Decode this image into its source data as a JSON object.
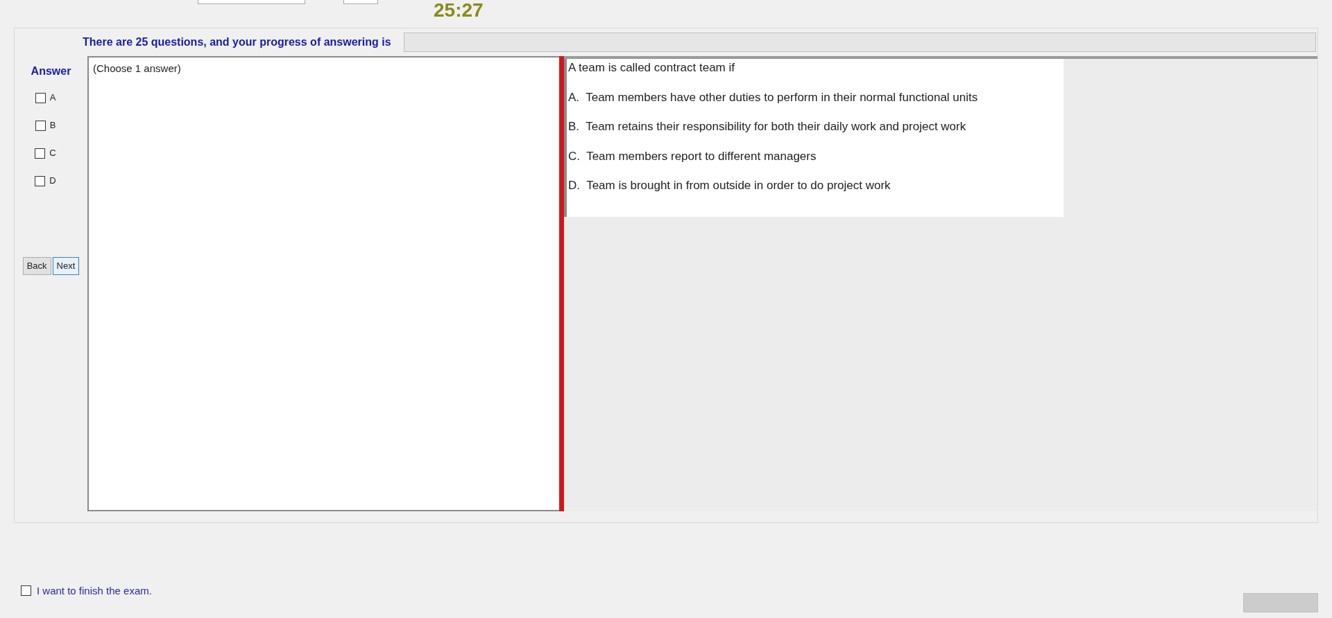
{
  "timer": "25:27",
  "progress": {
    "label": "There are 25 questions, and your progress of answering is",
    "level": 0
  },
  "answer": {
    "title": "Answer",
    "options": [
      {
        "label": "A",
        "checked": false
      },
      {
        "label": "B",
        "checked": false
      },
      {
        "label": "C",
        "checked": false
      },
      {
        "label": "D",
        "checked": false
      }
    ]
  },
  "nav_buttons": [
    {
      "label": "Back",
      "selected": false
    },
    {
      "label": "Next",
      "selected": true
    }
  ],
  "instruction": "(Choose 1 answer)",
  "question": {
    "text": "A team is called contract team if",
    "choices": [
      "A.  Team members have other duties to perform in their normal functional units",
      "B.  Team retains their responsibility for both their daily work and project work",
      "C.  Team members report to different managers",
      "D.  Team is brought in from outside in order to do project work"
    ]
  },
  "finish": {
    "label": "I want to finish the exam.",
    "checked": false
  }
}
